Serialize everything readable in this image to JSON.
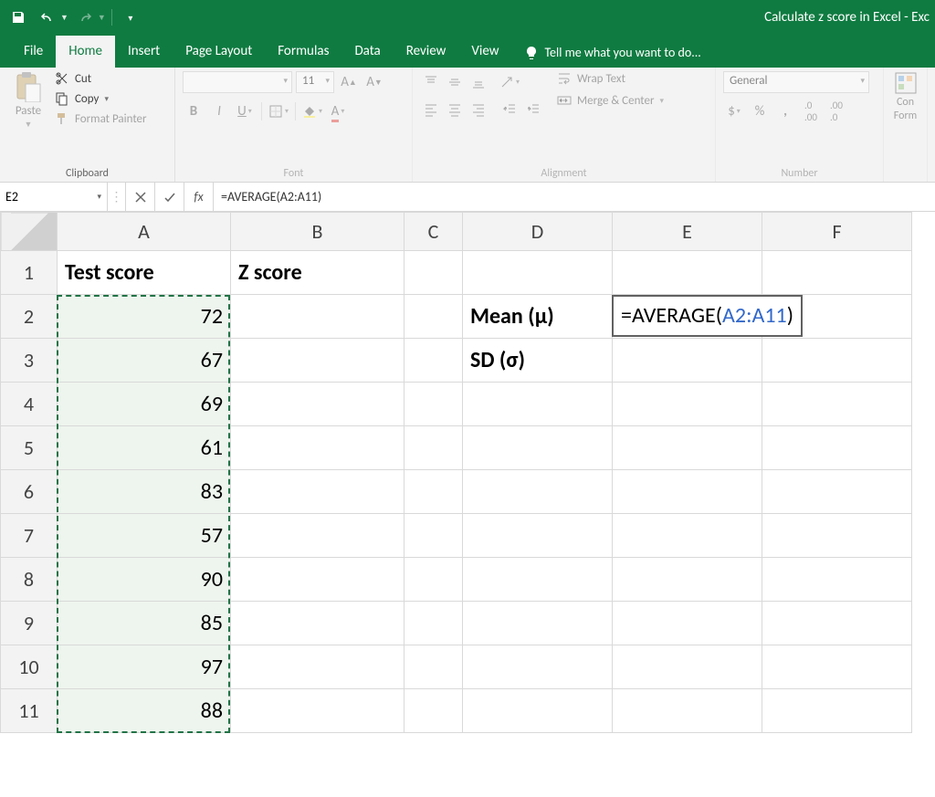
{
  "app": {
    "title": "Calculate z score in Excel - Exc"
  },
  "tabs": {
    "file": "File",
    "home": "Home",
    "insert": "Insert",
    "page_layout": "Page Layout",
    "formulas": "Formulas",
    "data": "Data",
    "review": "Review",
    "view": "View",
    "tell_me": "Tell me what you want to do..."
  },
  "ribbon": {
    "clipboard": {
      "paste": "Paste",
      "cut": "Cut",
      "copy": "Copy",
      "format_painter": "Format Painter",
      "label": "Clipboard"
    },
    "font": {
      "name": "",
      "size": "11",
      "label": "Font"
    },
    "alignment": {
      "wrap_text": "Wrap Text",
      "merge_center": "Merge & Center",
      "label": "Alignment"
    },
    "number": {
      "format": "General",
      "label": "Number"
    },
    "cond": {
      "line1": "Con",
      "line2": "Form"
    }
  },
  "formula_bar": {
    "name_box": "E2",
    "fx": "fx",
    "formula": "=AVERAGE(A2:A11)"
  },
  "columns": [
    "A",
    "B",
    "C",
    "D",
    "E",
    "F"
  ],
  "rows": [
    "1",
    "2",
    "3",
    "4",
    "5",
    "6",
    "7",
    "8",
    "9",
    "10",
    "11"
  ],
  "cells": {
    "A1": "Test score",
    "B1": "Z score",
    "A2": "72",
    "A3": "67",
    "A4": "69",
    "A5": "61",
    "A6": "83",
    "A7": "57",
    "A8": "90",
    "A9": "85",
    "A10": "97",
    "A11": "88",
    "D2": "Mean (μ)",
    "D3": "SD (σ)"
  },
  "editing": {
    "prefix": "=AVERAGE(",
    "ref": "A2:A11",
    "suffix": ")"
  }
}
